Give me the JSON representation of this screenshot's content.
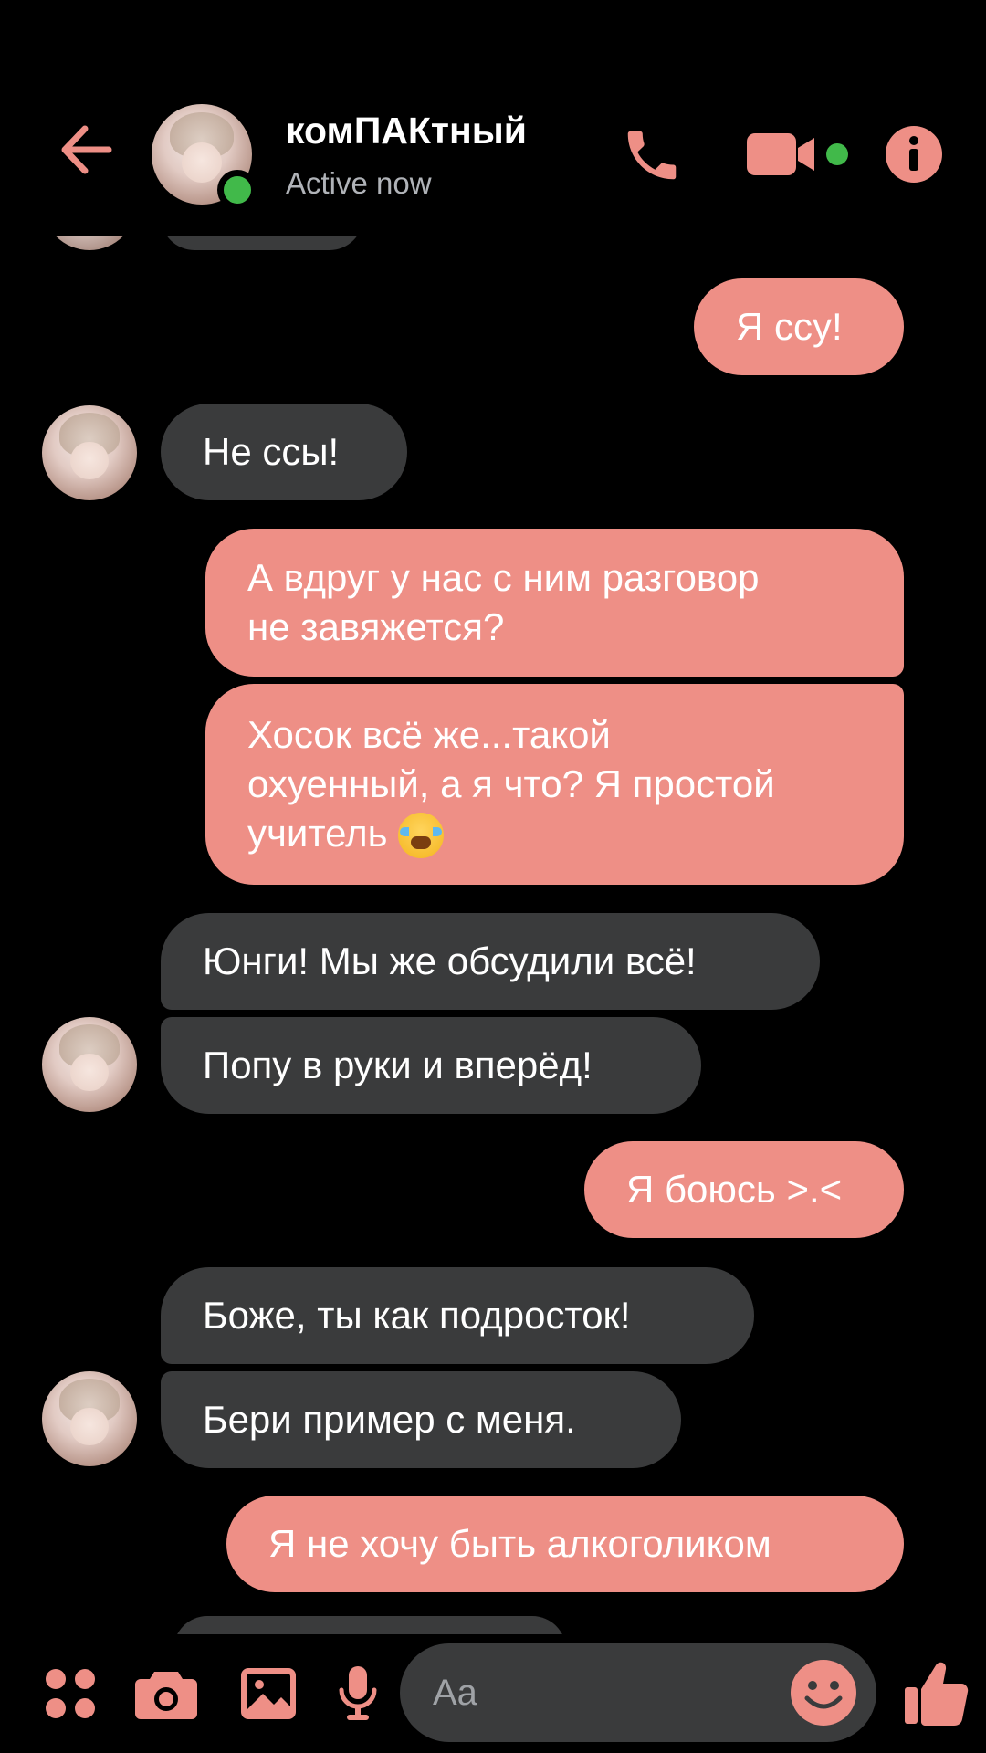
{
  "header": {
    "contact_name": "комПАКтный",
    "status": "Active now",
    "icons": [
      "back-arrow-icon",
      "phone-icon",
      "video-camera-icon",
      "info-icon"
    ]
  },
  "messages": [
    {
      "side": "out",
      "text": "Я ссу!"
    },
    {
      "side": "in",
      "text": "Не ссы!"
    },
    {
      "side": "out",
      "text": "А вдруг у нас с ним разговор\nне завяжется?"
    },
    {
      "side": "out",
      "text": "Хосок всё же...такой\nохуенный, а я что? Я простой\nучитель",
      "emoji": "loudly-crying-face-emoji"
    },
    {
      "side": "in",
      "text": "Юнги! Мы же обсудили всё!"
    },
    {
      "side": "in",
      "text": "Попу в руки и вперёд!"
    },
    {
      "side": "out",
      "text": "Я боюсь >.<"
    },
    {
      "side": "in",
      "text": "Боже, ты как подросток!"
    },
    {
      "side": "in",
      "text": "Бери пример с меня."
    },
    {
      "side": "out",
      "text": "Я не хочу быть алкоголиком"
    }
  ],
  "composer": {
    "placeholder": "Aa",
    "icons": [
      "menu-dots-icon",
      "camera-icon",
      "image-icon",
      "microphone-icon",
      "emoji-smile-icon",
      "thumbs-up-icon"
    ]
  },
  "colors": {
    "accent": "#ee8f86",
    "incoming_bubble": "#3a3b3c",
    "background": "#000000",
    "online": "#41b94a"
  }
}
